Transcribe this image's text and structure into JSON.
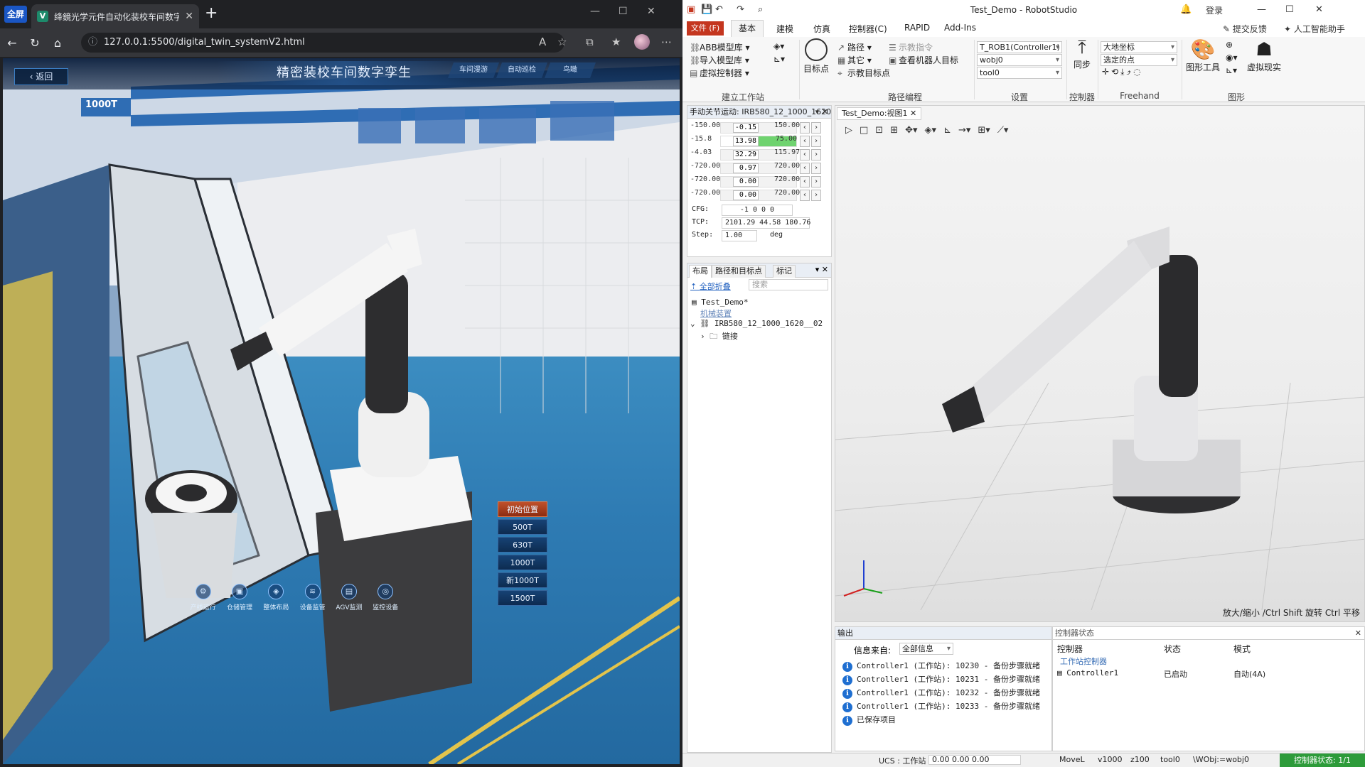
{
  "browser": {
    "logo": "全屏",
    "tab_title": "绛鏡光学元件自动化装校车间数字",
    "url": "127.0.0.1:5500/digital_twin_systemV2.html"
  },
  "scene": {
    "title": "精密装校车间数字孪生",
    "back_label": "返回",
    "tabs": [
      "车间漫游",
      "自动巡检",
      "鸟瞰"
    ],
    "machine_label": "1000T",
    "side_buttons": [
      "初始位置",
      "500T",
      "630T",
      "1000T",
      "新1000T",
      "1500T"
    ],
    "dock": [
      "产线运行",
      "仓储管理",
      "整体布局",
      "设备监管",
      "AGV监测",
      "监控设备"
    ]
  },
  "rs": {
    "title": "Test_Demo - RobotStudio",
    "login": "登录",
    "feedback": "提交反馈",
    "ai": "人工智能助手",
    "menu": {
      "file": "文件 (F)",
      "tabs": [
        "基本",
        "建模",
        "仿真",
        "控制器(C)",
        "RAPID",
        "Add-Ins"
      ]
    },
    "ribbon": {
      "abb_lib": "ABB模型库",
      "import_lib": "导入模型库",
      "virtual_ctrl": "虚拟控制器",
      "target": "目标点",
      "path": "路径",
      "other": "其它",
      "teach_target": "示教目标点",
      "teach_cmd": "示教指令",
      "view_robot_target": "查看机器人目标",
      "task": "T_ROB1(Controller1)",
      "wobj": "wobj0",
      "tool": "tool0",
      "frame": "大地坐标",
      "selected": "选定的点",
      "sync": "同步",
      "graphics_tools": "图形工具",
      "vr": "虚拟现实",
      "groups": [
        "建立工作站",
        "路径编程",
        "设置",
        "控制器",
        "Freehand",
        "图形"
      ]
    },
    "jog": {
      "header": "手动关节运动: IRB580_12_1000_1620_...",
      "rows": [
        {
          "min": "-150.00",
          "val": "-0.15",
          "max": "150.00"
        },
        {
          "min": "-15.8",
          "val": "13.98",
          "max": "75.00"
        },
        {
          "min": "-4.03",
          "val": "32.29",
          "max": "115.97"
        },
        {
          "min": "-720.00",
          "val": "0.97",
          "max": "720.00"
        },
        {
          "min": "-720.00",
          "val": "0.00",
          "max": "720.00"
        },
        {
          "min": "-720.00",
          "val": "0.00",
          "max": "720.00"
        }
      ],
      "cfg_label": "CFG:",
      "cfg": "-1 0 0 0",
      "tcp_label": "TCP:",
      "tcp": "2101.29 44.58 180.76",
      "step_label": "Step:",
      "step": "1.00",
      "step_unit": "deg"
    },
    "layout": {
      "tabs": [
        "布局",
        "路径和目标点",
        "标记"
      ],
      "collapse": "全部折叠",
      "search_placeholder": "搜索",
      "root": "Test_Demo*",
      "section": "机械装置",
      "robot": "IRB580_12_1000_1620__02",
      "links": "链接"
    },
    "view": {
      "tab": "Test_Demo:视图1",
      "hint": "放大/缩小  /Ctrl Shift  旋转  Ctrl  平移"
    },
    "output": {
      "title": "输出",
      "source_label": "信息来自:",
      "source": "全部信息",
      "lines": [
        "Controller1 (工作站): 10230 - 备份步骤就绪",
        "Controller1 (工作站): 10231 - 备份步骤就绪",
        "Controller1 (工作站): 10232 - 备份步骤就绪",
        "Controller1 (工作站): 10233 - 备份步骤就绪",
        "已保存项目"
      ]
    },
    "ctrl_status": {
      "title": "控制器状态",
      "cols": [
        "控制器",
        "状态",
        "模式"
      ],
      "group": "工作站控制器",
      "name": "Controller1",
      "state": "已启动",
      "mode": "自动(4A)"
    },
    "statusbar": {
      "ucs": "UCS : 工作站",
      "coords": "0.00  0.00  0.00",
      "move": "MoveL",
      "speed": "v1000",
      "zone": "z100",
      "tool": "tool0",
      "wobj": "\\WObj:=wobj0",
      "ctrl_state": "控制器状态: 1/1"
    }
  }
}
